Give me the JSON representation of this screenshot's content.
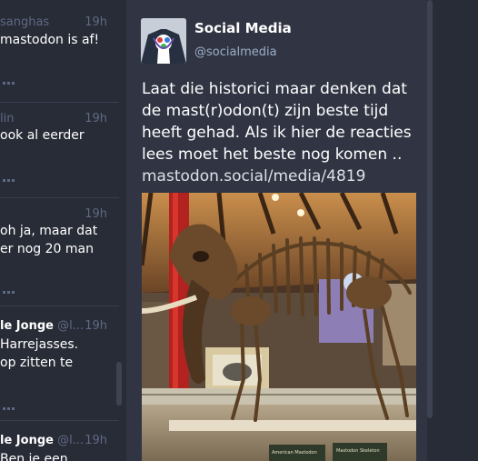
{
  "timeline": {
    "statuses": [
      {
        "name_bold": "",
        "name_rest": "sanghas",
        "time": "19h",
        "lines": [
          "mastodon is af!"
        ]
      },
      {
        "name_bold": "",
        "name_rest": "lin",
        "time": "19h",
        "lines": [
          "ook al eerder"
        ]
      },
      {
        "name_bold": "",
        "name_rest": "",
        "time": "19h",
        "lines": [
          "oh ja, maar dat",
          "er nog 20 man"
        ]
      },
      {
        "name_bold": "le Jonge",
        "name_rest": "@l...",
        "time": "19h",
        "lines": [
          "Harrejasses.",
          "op zitten te"
        ]
      },
      {
        "name_bold": "le Jonge",
        "name_rest": "@l...",
        "time": "19h",
        "lines": [
          "Ben je een"
        ]
      }
    ]
  },
  "toot": {
    "display_name": "Social Media",
    "handle": "@socialmedia",
    "text_lines": [
      "Laat die historici maar denken dat",
      "de mast(r)odon(t) zijn beste tijd",
      "heeft gehad. Als ik hier de reacties",
      "lees moet het beste nog komen .."
    ],
    "link": "mastodon.social/media/4819",
    "media_signs": [
      "American Mastodon",
      "Mastodon Skeleton"
    ]
  },
  "icons": {
    "more": "more-icon",
    "avatar": "avatar"
  }
}
